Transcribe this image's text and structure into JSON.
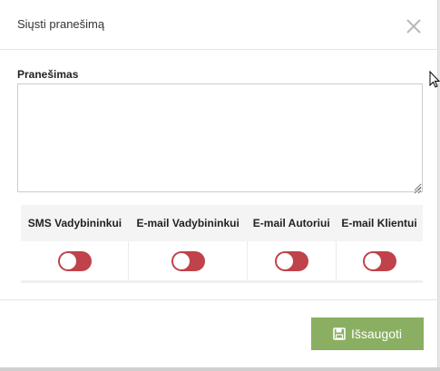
{
  "dialog": {
    "title": "Siųsti pranešimą",
    "close_icon": "close-icon"
  },
  "form": {
    "message_label": "Pranešimas",
    "message_value": ""
  },
  "notifications": {
    "headers": [
      "SMS Vadybininkui",
      "E-mail Vadybininkui",
      "E-mail Autoriui",
      "E-mail Klientui"
    ],
    "toggles": [
      {
        "on": false
      },
      {
        "on": false
      },
      {
        "on": false
      },
      {
        "on": false
      }
    ],
    "toggle_off_color": "#c0424a"
  },
  "footer": {
    "save_label": "Išsaugoti",
    "save_icon": "floppy-disk-icon",
    "save_color": "#8aaf62"
  }
}
